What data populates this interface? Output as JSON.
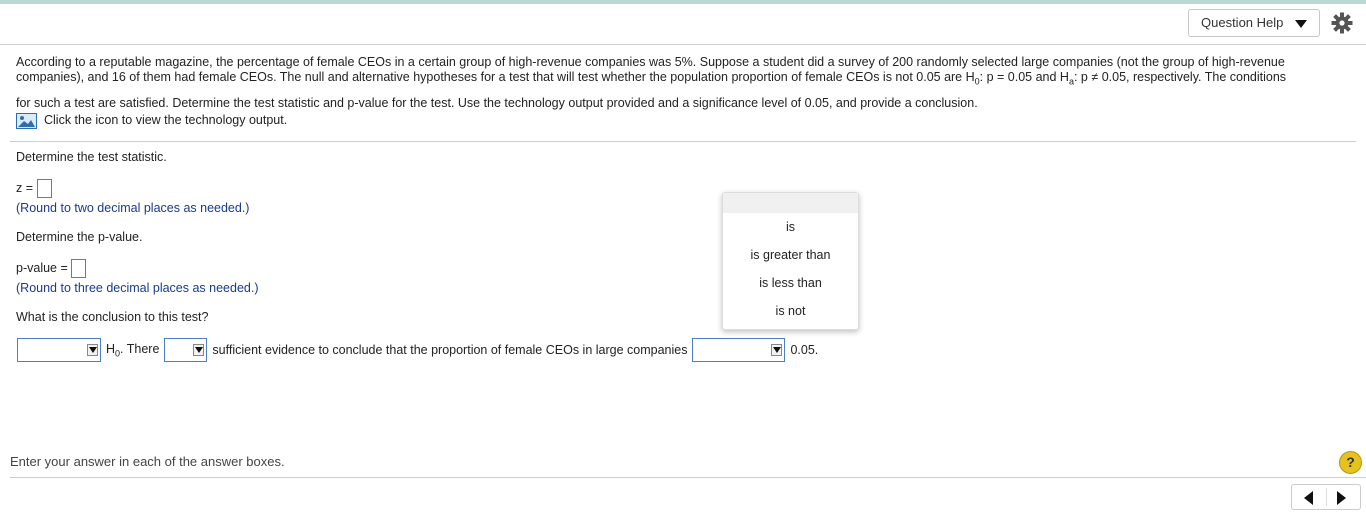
{
  "header": {
    "question_help_label": "Question Help"
  },
  "question": {
    "line1": "According to a reputable magazine, the percentage of female CEOs in a certain group of high-revenue companies was 5%. Suppose a student did a survey of 200 randomly selected large companies (not the group of high-revenue",
    "line2_part1": "companies), and 16 of them had female CEOs. The null and alternative hypotheses for a test that will test whether the population proportion of female CEOs is not 0.05 are H",
    "line2_sub1": "0",
    "line2_part2": ": p = 0.05 and H",
    "line2_sub2": "a",
    "line2_part3": ": p ≠ 0.05, respectively. The conditions",
    "line3": "for such a test are satisfied. Determine the test statistic and p-value for the test. Use the technology output provided and a significance level of 0.05, and provide a conclusion.",
    "tech_link": "Click the icon to view the technology output."
  },
  "part1": {
    "prompt": "Determine the test statistic.",
    "label": "z =",
    "hint": "(Round to two decimal places as needed.)"
  },
  "part2": {
    "prompt": "Determine the p-value.",
    "label": "p-value =",
    "hint": "(Round to three decimal places as needed.)"
  },
  "part3": {
    "prompt": "What is the conclusion to this test?",
    "h_text": "H",
    "h_sub": "0",
    "there_text": ". There",
    "middle_text": "sufficient evidence to conclude that the proportion of female CEOs in large companies",
    "end_value": "0.05."
  },
  "dropdown_options": [
    "is",
    "is greater than",
    "is less than",
    "is not"
  ],
  "footer": {
    "instruction": "Enter your answer in each of the answer boxes.",
    "help_symbol": "?"
  },
  "colors": {
    "hint_blue": "#1a3a8c",
    "answer_box_green": "#3a9e5c",
    "select_border_blue": "#4d7fc7",
    "help_yellow": "#e6c21e"
  }
}
